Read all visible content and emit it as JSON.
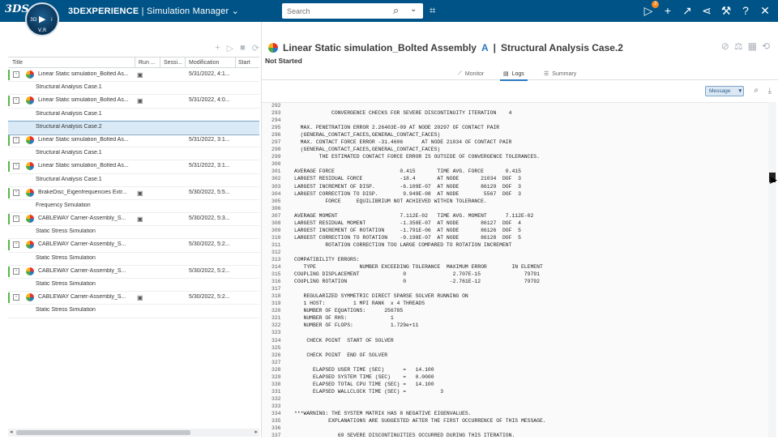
{
  "topbar": {
    "brand_logo": "3DS",
    "compass": {
      "top": "3D",
      "left": "V,R",
      "right": "i"
    },
    "brand": "3DEXPERIENCE",
    "separator": "|",
    "app_name": "Simulation Manager",
    "search_placeholder": "Search",
    "notification_count": "3",
    "icons": [
      "tag-icon",
      "chat-icon",
      "add-icon",
      "share-icon",
      "network-icon",
      "tools-icon",
      "help-icon",
      "collapse-icon"
    ]
  },
  "tree": {
    "columns": [
      "Title",
      "Run ...",
      "Sessi...",
      "Modification",
      "Start"
    ],
    "rows": [
      {
        "type": "parent",
        "title": "Linear Static simulation_Bolted As...",
        "run": true,
        "mod": "5/31/2022, 4:1...",
        "expander": "-"
      },
      {
        "type": "child",
        "title": "Structural Analysis Case.1"
      },
      {
        "type": "parent",
        "title": "Linear Static simulation_Bolted As...",
        "run": true,
        "mod": "5/31/2022, 4:0...",
        "expander": "-"
      },
      {
        "type": "child",
        "title": "Structural Analysis Case.1"
      },
      {
        "type": "child",
        "title": "Structural Analysis Case.2",
        "selected": true
      },
      {
        "type": "parent",
        "title": "Linear Static simulation_Bolted As...",
        "run": false,
        "mod": "5/31/2022, 3:1...",
        "expander": "-"
      },
      {
        "type": "child",
        "title": "Structural Analysis Case.1"
      },
      {
        "type": "parent",
        "title": "Linear Static simulation_Bolted As...",
        "run": false,
        "mod": "5/31/2022, 3:1...",
        "expander": "-"
      },
      {
        "type": "child",
        "title": "Structural Analysis Case.1"
      },
      {
        "type": "parent",
        "title": "BrakeDisc_Eigenfrequencies Extr...",
        "run": true,
        "mod": "5/30/2022, 5:5...",
        "expander": "-"
      },
      {
        "type": "child",
        "title": "Frequency Simulation"
      },
      {
        "type": "parent",
        "title": "CABLEWAY Carrier-Assembly_S...",
        "run": true,
        "mod": "5/30/2022, 5:3...",
        "expander": "-"
      },
      {
        "type": "child",
        "title": "Static Stress Simulation"
      },
      {
        "type": "parent",
        "title": "CABLEWAY Carrier-Assembly_S...",
        "run": false,
        "mod": "5/30/2022, 5:2...",
        "expander": "-"
      },
      {
        "type": "child",
        "title": "Static Stress Simulation"
      },
      {
        "type": "parent",
        "title": "CABLEWAY Carrier-Assembly_S...",
        "run": false,
        "mod": "5/30/2022, 5:2...",
        "expander": "-"
      },
      {
        "type": "child",
        "title": "Static Stress Simulation"
      },
      {
        "type": "parent",
        "title": "CABLEWAY Carrier-Assembly_S...",
        "run": true,
        "mod": "5/30/2022, 5:2...",
        "expander": "-"
      },
      {
        "type": "child",
        "title": "Static Stress Simulation"
      }
    ]
  },
  "document": {
    "title_main": "Linear Static simulation_Bolted Assembly",
    "title_version": "A",
    "title_sep": "|",
    "title_case": "Structural Analysis Case.2",
    "status": "Not Started",
    "tabs": [
      "Monitor",
      "Logs",
      "Summary"
    ],
    "active_tab": "Logs",
    "filter_label": "Message"
  },
  "log": [
    [
      "292",
      ""
    ],
    [
      "293",
      "            CONVERGENCE CHECKS FOR SEVERE DISCONTINUITY ITERATION    4"
    ],
    [
      "294",
      ""
    ],
    [
      "295",
      "  MAX. PENETRATION ERROR 2.26403E-09 AT NODE 20297 OF CONTACT PAIR"
    ],
    [
      "296",
      "  (GENERAL_CONTACT_FACES,GENERAL_CONTACT_FACES)"
    ],
    [
      "297",
      "  MAX. CONTACT FORCE ERROR -31.4606      AT NODE 21034 OF CONTACT PAIR"
    ],
    [
      "298",
      "  (GENERAL_CONTACT_FACES,GENERAL_CONTACT_FACES)"
    ],
    [
      "299",
      "        THE ESTIMATED CONTACT FORCE ERROR IS OUTSIDE OF CONVERGENCE TOLERANCES."
    ],
    [
      "300",
      ""
    ],
    [
      "301",
      "AVERAGE FORCE                     0.415       TIME AVG. FORCE       0.415"
    ],
    [
      "302",
      "LARGEST RESIDUAL FORCE            -18.4       AT NODE       21034  DOF  3"
    ],
    [
      "303",
      "LARGEST INCREMENT OF DISP.        -6.109E-07  AT NODE       86129  DOF  3"
    ],
    [
      "304",
      "LARGEST CORRECTION TO DISP.        9.949E-08  AT NODE        5567  DOF  3"
    ],
    [
      "305",
      "          FORCE     EQUILIBRIUM NOT ACHIEVED WITHIN TOLERANCE."
    ],
    [
      "306",
      ""
    ],
    [
      "307",
      "AVERAGE MOMENT                    7.112E-02   TIME AVG. MOMENT      7.112E-02"
    ],
    [
      "308",
      "LARGEST RESIDUAL MOMENT           -1.358E-07  AT NODE       86127  DOF  4"
    ],
    [
      "309",
      "LARGEST INCREMENT OF ROTATION     -1.791E-06  AT NODE       86126  DOF  5"
    ],
    [
      "310",
      "LARGEST CORRECTION TO ROTATION    -9.198E-07  AT NODE       86128  DOF  5"
    ],
    [
      "311",
      "          ROTATION CORRECTION TOO LARGE COMPARED TO ROTATION INCREMENT"
    ],
    [
      "312",
      ""
    ],
    [
      "313",
      "COMPATIBILITY ERRORS:"
    ],
    [
      "314",
      "   TYPE              NUMBER EXCEEDING TOLERANCE  MAXIMUM ERROR        IN ELEMENT"
    ],
    [
      "315",
      "COUPLING DISPLACEMENT              0               2.707E-15              79791"
    ],
    [
      "316",
      "COUPLING ROTATION                  0              -2.761E-12              79792"
    ],
    [
      "317",
      ""
    ],
    [
      "318",
      "   REGULARIZED SYMMETRIC DIRECT SPARSE SOLVER RUNNING ON"
    ],
    [
      "319",
      "   1 HOST:         1 MPI RANK  x 4 THREADS"
    ],
    [
      "320",
      "   NUMBER OF EQUATIONS:      256785"
    ],
    [
      "321",
      "   NUMBER OF RHS:              1"
    ],
    [
      "322",
      "   NUMBER OF FLOPS:            1.729e+11"
    ],
    [
      "323",
      ""
    ],
    [
      "324",
      "    CHECK POINT  START OF SOLVER"
    ],
    [
      "325",
      ""
    ],
    [
      "326",
      "    CHECK POINT  END OF SOLVER"
    ],
    [
      "327",
      ""
    ],
    [
      "328",
      "      ELAPSED USER TIME (SEC)      =   14.100"
    ],
    [
      "329",
      "      ELAPSED SYSTEM TIME (SEC)    =   0.0000"
    ],
    [
      "330",
      "      ELAPSED TOTAL CPU TIME (SEC) =   14.100"
    ],
    [
      "331",
      "      ELAPSED WALLCLOCK TIME (SEC) =           3"
    ],
    [
      "332",
      ""
    ],
    [
      "333",
      ""
    ],
    [
      "334",
      "***WARNING: THE SYSTEM MATRIX HAS 8 NEGATIVE EIGENVALUES."
    ],
    [
      "335",
      "           EXPLANATIONS ARE SUGGESTED AFTER THE FIRST OCCURRENCE OF THIS MESSAGE."
    ],
    [
      "336",
      ""
    ],
    [
      "337",
      "              69 SEVERE DISCONTINUITIES OCCURRED DURING THIS ITERATION."
    ]
  ]
}
